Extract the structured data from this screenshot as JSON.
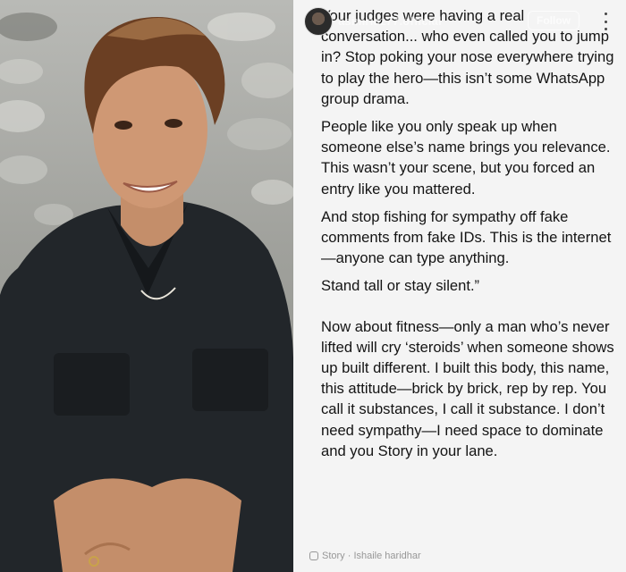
{
  "story": {
    "username": "asimriaz77.official",
    "follow_label": "Follow",
    "paragraphs": [
      "Your judges were having a real conversation... who even called you to jump in? Stop poking your nose everywhere trying to play the hero—this isn’t some WhatsApp group drama.",
      "People like you only speak up when someone else’s name brings you relevance. This wasn’t your scene, but you forced an entry like you mattered.",
      "And stop fishing for sympathy off fake comments from fake IDs. This is the internet—anyone can type anything.",
      "Stand tall or stay silent.”",
      "Now about fitness—only a man who’s never lifted will cry ‘steroids’ when someone shows up built different. I built this body, this name, this attitude—brick by brick, rep by rep. You call it substances, I call it substance. I don’t need sympathy—I need space to dominate and you Story in your lane."
    ],
    "watermark": "Story · Ishaile haridhar"
  },
  "colors": {
    "story_bg": "#f4f4f4",
    "text": "#141414",
    "shirt": "#1f2327"
  }
}
